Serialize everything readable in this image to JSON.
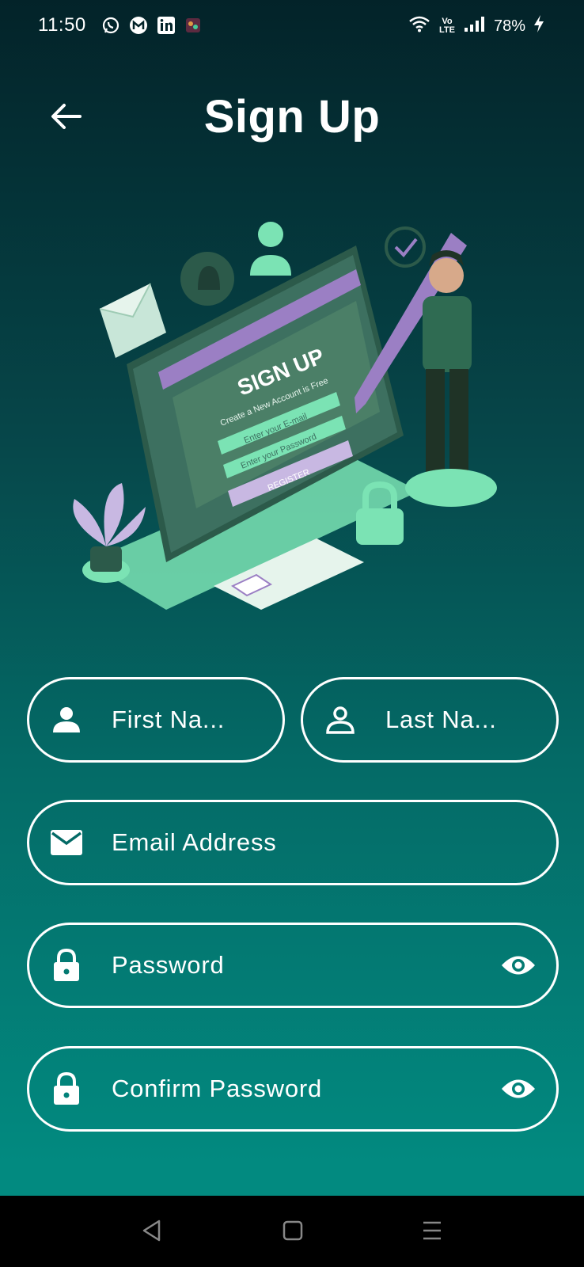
{
  "status_bar": {
    "time": "11:50",
    "app_icons": [
      "whatsapp-icon",
      "gmail-icon",
      "linkedin-icon",
      "app-icon"
    ],
    "network": "Vo LTE",
    "battery": "78%"
  },
  "header": {
    "title": "Sign Up",
    "back_icon": "arrow-left-icon"
  },
  "illustration": {
    "screen_title": "SIGN UP",
    "screen_subtitle": "Create a New Account is Free",
    "email_placeholder": "Enter your E-mail",
    "password_placeholder": "Enter your Password",
    "register_label": "REGISTER"
  },
  "form": {
    "first_name": {
      "placeholder": "First Na...",
      "icon": "person-icon"
    },
    "last_name": {
      "placeholder": "Last Na...",
      "icon": "person-outline-icon"
    },
    "email": {
      "placeholder": "Email Address",
      "icon": "mail-icon"
    },
    "password": {
      "placeholder": "Password",
      "icon": "lock-icon",
      "toggle_icon": "eye-icon"
    },
    "confirm_password": {
      "placeholder": "Confirm Password",
      "icon": "lock-icon",
      "toggle_icon": "eye-icon"
    }
  },
  "colors": {
    "background_top": "#032329",
    "background_bottom": "#028a80",
    "accent_purple": "#9b7fc4",
    "accent_mint": "#7be3b4"
  },
  "nav_bar": [
    "back-nav-icon",
    "home-nav-icon",
    "recents-nav-icon"
  ]
}
